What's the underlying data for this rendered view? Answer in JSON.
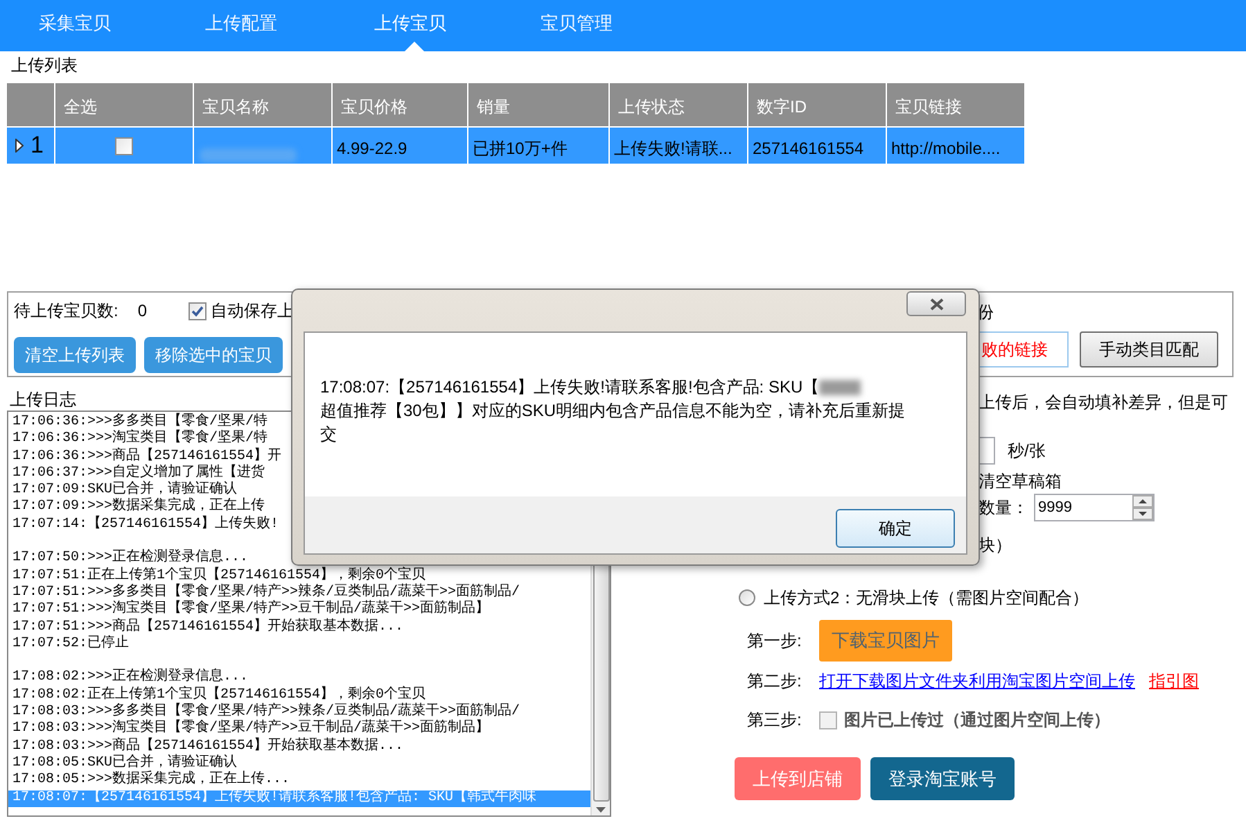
{
  "tabs": [
    {
      "label": "采集宝贝",
      "selected": false
    },
    {
      "label": "上传配置",
      "selected": false
    },
    {
      "label": "上传宝贝",
      "selected": true
    },
    {
      "label": "宝贝管理",
      "selected": false
    }
  ],
  "upload_list": {
    "title": "上传列表",
    "columns": [
      "全选",
      "宝贝名称",
      "宝贝价格",
      "销量",
      "上传状态",
      "数字ID",
      "宝贝链接"
    ],
    "rows": [
      {
        "index": "1",
        "selected": true,
        "checked": false,
        "price": "4.99-22.9",
        "sales": "已拼10万+件",
        "status": "上传失败!请联...",
        "id": "257146161554",
        "link": "http://mobile...."
      }
    ]
  },
  "toolbar": {
    "pending_label": "待上传宝贝数:",
    "pending_count": "0",
    "auto_save": {
      "label": "自动保存上",
      "checked": true
    },
    "auto_save_tail": "份",
    "buttons": [
      "清空上传列表",
      "移除选中的宝贝"
    ],
    "failed_links_button": "败的链接",
    "category_button": "手动类目匹配"
  },
  "log": {
    "title": "上传日志",
    "lines": [
      {
        "kind": "text",
        "text": "17:06:36:>>>多多类目【零食/坚果/特",
        "selected": false
      },
      {
        "kind": "text",
        "text": "17:06:36:>>>淘宝类目【零食/坚果/特",
        "selected": false
      },
      {
        "kind": "text",
        "text": "17:06:36:>>>商品【257146161554】开",
        "selected": false
      },
      {
        "kind": "text",
        "text": "17:06:37:>>>自定义增加了属性【进货",
        "selected": false
      },
      {
        "kind": "text",
        "text": "17:07:09:SKU已合并，请验证确认",
        "selected": false
      },
      {
        "kind": "text",
        "text": "17:07:09:>>>数据采集完成，正在上传",
        "selected": false
      },
      {
        "kind": "text",
        "text": "17:07:14:【257146161554】上传失败!",
        "selected": false
      },
      {
        "kind": "blank"
      },
      {
        "kind": "text",
        "text": "17:07:50:>>>正在检测登录信息...",
        "selected": false
      },
      {
        "kind": "text",
        "text": "17:07:51:正在上传第1个宝贝【257146161554】，剩余0个宝贝",
        "selected": false
      },
      {
        "kind": "text",
        "text": "17:07:51:>>>多多类目【零食/坚果/特产>>辣条/豆类制品/蔬菜干>>面筋制品/",
        "selected": false
      },
      {
        "kind": "text",
        "text": "17:07:51:>>>淘宝类目【零食/坚果/特产>>豆干制品/蔬菜干>>面筋制品】",
        "selected": false
      },
      {
        "kind": "text",
        "text": "17:07:51:>>>商品【257146161554】开始获取基本数据...",
        "selected": false
      },
      {
        "kind": "text",
        "text": "17:07:52:已停止",
        "selected": false
      },
      {
        "kind": "blank"
      },
      {
        "kind": "text",
        "text": "17:08:02:>>>正在检测登录信息...",
        "selected": false
      },
      {
        "kind": "text",
        "text": "17:08:02:正在上传第1个宝贝【257146161554】，剩余0个宝贝",
        "selected": false
      },
      {
        "kind": "text",
        "text": "17:08:03:>>>多多类目【零食/坚果/特产>>辣条/豆类制品/蔬菜干>>面筋制品/",
        "selected": false
      },
      {
        "kind": "text",
        "text": "17:08:03:>>>淘宝类目【零食/坚果/特产>>豆干制品/蔬菜干>>面筋制品】",
        "selected": false
      },
      {
        "kind": "text",
        "text": "17:08:03:>>>商品【257146161554】开始获取基本数据...",
        "selected": false
      },
      {
        "kind": "text",
        "text": "17:08:05:SKU已合并，请验证确认",
        "selected": false
      },
      {
        "kind": "text",
        "text": "17:08:05:>>>数据采集完成，正在上传...",
        "selected": false
      },
      {
        "kind": "text",
        "text": "17:08:07:【257146161554】上传失败!请联系客服!包含产品: SKU【韩式牛肉味",
        "selected": true
      }
    ]
  },
  "settings": {
    "note": "上传后，会自动填补差异，但是可",
    "interval_unit": "秒/张",
    "clear_drafts": "清空草稿箱",
    "quantity_label": "数量：",
    "quantity": "9999",
    "tail": "块）"
  },
  "method2": {
    "label": "上传方式2：无滑块上传（需图片空间配合）",
    "selected": false,
    "steps": [
      {
        "kind": "button",
        "label": "第一步:",
        "action": "下载宝贝图片",
        "disabled": true
      },
      {
        "kind": "link",
        "label": "第二步:",
        "action": "打开下载图片文件夹利用淘宝图片空间上传",
        "extra": "指引图"
      },
      {
        "kind": "checkbox",
        "label": "第三步:",
        "action": "图片已上传过（通过图片空间上传）",
        "checked": false,
        "disabled": true
      }
    ]
  },
  "actions": [
    {
      "label": "上传到店铺",
      "kind": "primary"
    },
    {
      "label": "登录淘宝账号",
      "kind": "secondary"
    }
  ],
  "dialog": {
    "message_before": "17:08:07:【257146161554】上传失败!请联系客服!包含产品: SKU【",
    "message_after": "超值推荐【30包】】对应的SKU明细内包含产品信息不能为空，请补充后重新提交",
    "ok": "确定"
  }
}
